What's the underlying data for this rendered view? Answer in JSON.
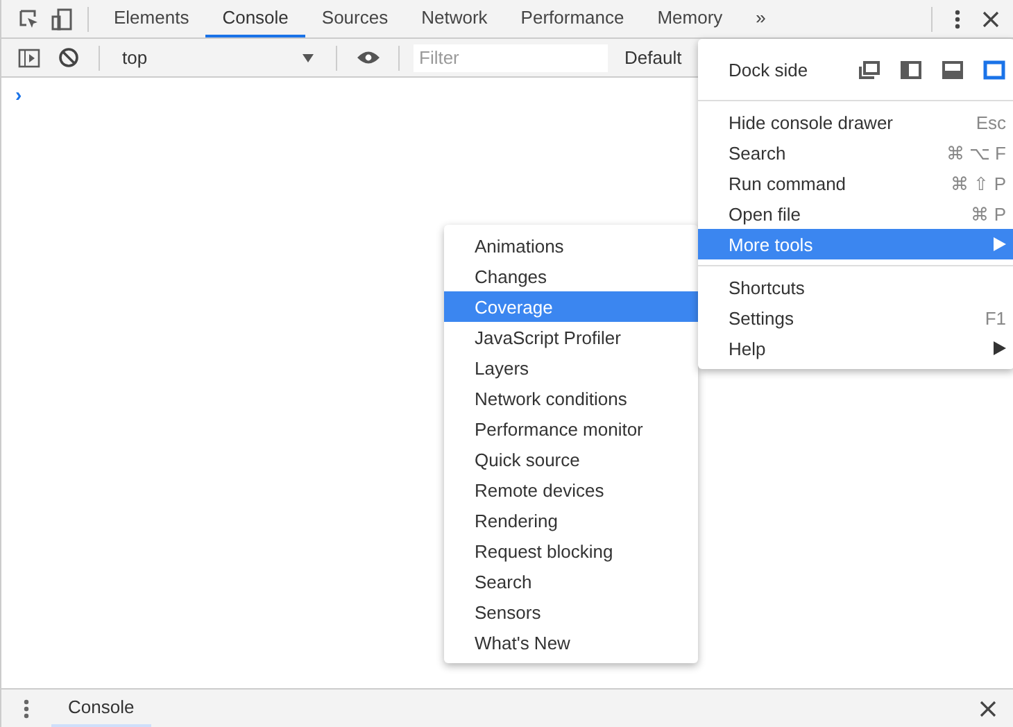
{
  "tabs": [
    {
      "label": "Elements",
      "selected": false
    },
    {
      "label": "Console",
      "selected": true
    },
    {
      "label": "Sources",
      "selected": false
    },
    {
      "label": "Network",
      "selected": false
    },
    {
      "label": "Performance",
      "selected": false
    },
    {
      "label": "Memory",
      "selected": false
    }
  ],
  "more_tabs": "»",
  "toolbar": {
    "context": "top",
    "filter_placeholder": "Filter",
    "levels": "Default"
  },
  "prompt": "›",
  "menu": {
    "dock_label": "Dock side",
    "dock_options": [
      {
        "kind": "undock",
        "selected": false
      },
      {
        "kind": "left",
        "selected": false
      },
      {
        "kind": "bottom",
        "selected": false
      },
      {
        "kind": "right",
        "selected": true
      }
    ],
    "sections": [
      [
        {
          "label": "Hide console drawer",
          "shortcut": "Esc",
          "selected": false,
          "submenu": false
        },
        {
          "label": "Search",
          "shortcut": "⌘ ⌥ F",
          "selected": false,
          "submenu": false
        },
        {
          "label": "Run command",
          "shortcut": "⌘ ⇧ P",
          "selected": false,
          "submenu": false
        },
        {
          "label": "Open file",
          "shortcut": "⌘ P",
          "selected": false,
          "submenu": false
        },
        {
          "label": "More tools",
          "selected": true,
          "submenu": true
        }
      ],
      [
        {
          "label": "Shortcuts",
          "selected": false,
          "submenu": false
        },
        {
          "label": "Settings",
          "shortcut": "F1",
          "selected": false,
          "submenu": false
        },
        {
          "label": "Help",
          "selected": false,
          "submenu": true
        }
      ]
    ]
  },
  "submenu": [
    {
      "label": "Animations",
      "selected": false
    },
    {
      "label": "Changes",
      "selected": false
    },
    {
      "label": "Coverage",
      "selected": true
    },
    {
      "label": "JavaScript Profiler",
      "selected": false
    },
    {
      "label": "Layers",
      "selected": false
    },
    {
      "label": "Network conditions",
      "selected": false
    },
    {
      "label": "Performance monitor",
      "selected": false
    },
    {
      "label": "Quick source",
      "selected": false
    },
    {
      "label": "Remote devices",
      "selected": false
    },
    {
      "label": "Rendering",
      "selected": false
    },
    {
      "label": "Request blocking",
      "selected": false
    },
    {
      "label": "Search",
      "selected": false
    },
    {
      "label": "Sensors",
      "selected": false
    },
    {
      "label": "What's New",
      "selected": false
    }
  ],
  "drawer": {
    "tab": "Console"
  }
}
